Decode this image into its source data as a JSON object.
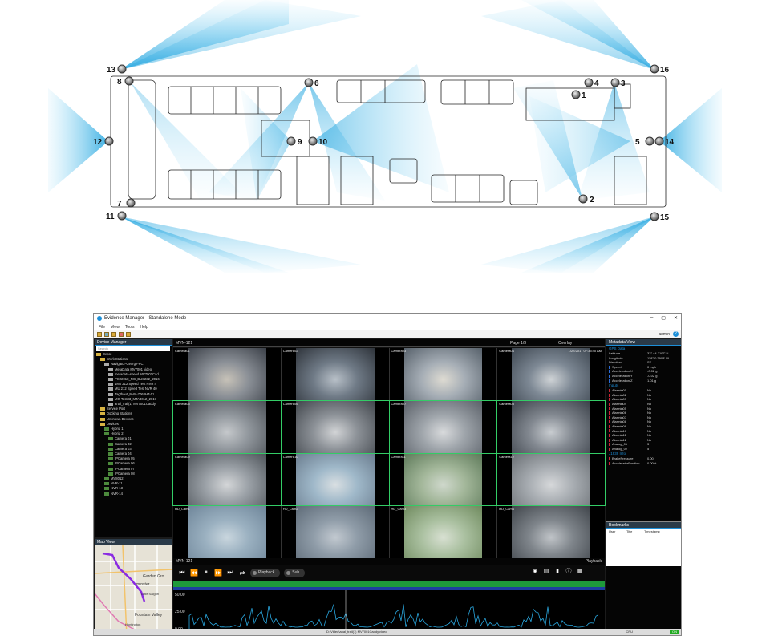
{
  "bus_diagram": {
    "cameras": [
      {
        "num": "1"
      },
      {
        "num": "2"
      },
      {
        "num": "3"
      },
      {
        "num": "4"
      },
      {
        "num": "5"
      },
      {
        "num": "6"
      },
      {
        "num": "7"
      },
      {
        "num": "8"
      },
      {
        "num": "9"
      },
      {
        "num": "10"
      },
      {
        "num": "11"
      },
      {
        "num": "12"
      },
      {
        "num": "13"
      },
      {
        "num": "14"
      },
      {
        "num": "15"
      },
      {
        "num": "16"
      }
    ]
  },
  "app": {
    "title": "Evidence Manager - Standalone Mode",
    "window_controls": [
      "–",
      "▢",
      "✕"
    ],
    "menu": [
      "File",
      "View",
      "Tools",
      "Help"
    ],
    "user": "admin",
    "device_manager": {
      "header": "Device Manager",
      "search_placeholder": "Search",
      "tree": [
        {
          "label": "Depot",
          "type": "folder",
          "indent": 0
        },
        {
          "label": "Work Stations",
          "type": "folder",
          "indent": 1
        },
        {
          "label": "Navigator-George-PC",
          "type": "device",
          "indent": 2
        },
        {
          "label": "MetaData MV7001 video",
          "type": "file",
          "indent": 3
        },
        {
          "label": "metadata-speed MV7001Cad",
          "type": "file",
          "indent": 3
        },
        {
          "label": "PC22018_RG_BUS232_2016",
          "type": "file",
          "indent": 3
        },
        {
          "label": "1M0 212 Speed Test NVR 4",
          "type": "file",
          "indent": 3
        },
        {
          "label": "MU 212 Speed Test NVR 40",
          "type": "file",
          "indent": 3
        },
        {
          "label": "Tagthout_NVN-7068HT-01",
          "type": "file",
          "indent": 3
        },
        {
          "label": "MG Test33_MTA3012_2017",
          "type": "file",
          "indent": 3
        },
        {
          "label": "anal_trail(1) MV7001Caddy",
          "type": "file",
          "indent": 3
        },
        {
          "label": "Service Port",
          "type": "folder",
          "indent": 1
        },
        {
          "label": "Docking Stations",
          "type": "folder",
          "indent": 1
        },
        {
          "label": "Unknown Devices",
          "type": "folder",
          "indent": 1
        },
        {
          "label": "Devices",
          "type": "folder",
          "indent": 1
        },
        {
          "label": "Hybrid 1",
          "type": "camera",
          "indent": 2
        },
        {
          "label": "Hybrid 2",
          "type": "camera",
          "indent": 2
        },
        {
          "label": "Camera 01",
          "type": "camera",
          "indent": 3
        },
        {
          "label": "Camera 02",
          "type": "camera",
          "indent": 3
        },
        {
          "label": "Camera 03",
          "type": "camera",
          "indent": 3
        },
        {
          "label": "Camera 04",
          "type": "camera",
          "indent": 3
        },
        {
          "label": "IPCamera 05",
          "type": "camera",
          "indent": 3
        },
        {
          "label": "IPCamera 06",
          "type": "camera",
          "indent": 3
        },
        {
          "label": "IPCamera 07",
          "type": "camera",
          "indent": 3
        },
        {
          "label": "IPCamera 08",
          "type": "camera",
          "indent": 3
        },
        {
          "label": "MV8012",
          "type": "camera",
          "indent": 2
        },
        {
          "label": "NVR-11",
          "type": "camera",
          "indent": 2
        },
        {
          "label": "NVR-13",
          "type": "camera",
          "indent": 2
        },
        {
          "label": "NVR-14",
          "type": "camera",
          "indent": 2
        }
      ]
    },
    "map_view": {
      "header": "Map View",
      "places": [
        "Garden Gro",
        "minster",
        "Little Saigon",
        "Fountain Valley",
        "Huntington"
      ],
      "attribution": "Data, imagery and map information provided by Open Stre"
    },
    "video": {
      "title": "MVN-121",
      "page": "Page 1/3",
      "overlay": "Overlay",
      "timestamp": "1/27/2017 07:35:40 AM",
      "cells": [
        {
          "label": "Camera01"
        },
        {
          "label": "Camera02"
        },
        {
          "label": "Camera03"
        },
        {
          "label": "Camera04"
        },
        {
          "label": "Camera05"
        },
        {
          "label": "Camera06"
        },
        {
          "label": "Camera07"
        },
        {
          "label": "Camera08"
        },
        {
          "label": "Camera09"
        },
        {
          "label": "Camera10"
        },
        {
          "label": "Camera11"
        },
        {
          "label": "Camera12"
        },
        {
          "label": "HD_Cam1"
        },
        {
          "label": "HD_Cam2"
        },
        {
          "label": "HD_Cam3"
        },
        {
          "label": "HD_Cam4"
        }
      ],
      "lower_title": "MVN-121",
      "playback_label": "Playback",
      "play_btn": "Playback",
      "sub_btn": "Sub",
      "wave_ticks": [
        "50.00",
        "25.00",
        "0.00"
      ]
    },
    "metadata": {
      "header": "Metadata View",
      "gps_title": "GPS Data",
      "gps": [
        {
          "k": "Latitude",
          "v": "33° 44.7107' N",
          "c": ""
        },
        {
          "k": "Longitude",
          "v": "118° 0.3903' W",
          "c": ""
        },
        {
          "k": "Direction",
          "v": "SE",
          "c": ""
        },
        {
          "k": "Speed",
          "v": "0 mph",
          "c": "#2a6cd8"
        },
        {
          "k": "Acceleration X",
          "v": "-0.02 g",
          "c": "#2a6cd8"
        },
        {
          "k": "Acceleration Y",
          "v": "-0.02 g",
          "c": "#2a6cd8"
        },
        {
          "k": "Acceleration Z",
          "v": "1.01 g",
          "c": "#2a6cd8"
        }
      ],
      "inputs_title": "Inputs",
      "inputs": [
        {
          "k": "Alarmin01",
          "v": "No",
          "c": "#c23"
        },
        {
          "k": "Alarmin02",
          "v": "No",
          "c": "#c23"
        },
        {
          "k": "Alarmin03",
          "v": "No",
          "c": "#c23"
        },
        {
          "k": "Alarmin04",
          "v": "No",
          "c": "#c23"
        },
        {
          "k": "Alarmin05",
          "v": "No",
          "c": "#c23"
        },
        {
          "k": "Alarmin06",
          "v": "No",
          "c": "#c23"
        },
        {
          "k": "Alarmin07",
          "v": "No",
          "c": "#c23"
        },
        {
          "k": "Alarmin08",
          "v": "No",
          "c": "#c23"
        },
        {
          "k": "Alarmin09",
          "v": "No",
          "c": "#c23"
        },
        {
          "k": "Alarmin10",
          "v": "No",
          "c": "#c23"
        },
        {
          "k": "Alarmin11",
          "v": "No",
          "c": "#c23"
        },
        {
          "k": "Alarmin12",
          "v": "No",
          "c": "#c23"
        },
        {
          "k": "Analog_01",
          "v": "3",
          "c": "#c23"
        },
        {
          "k": "Analog_02",
          "v": "5",
          "c": "#c23"
        }
      ],
      "j1939_title": "J1939 Info",
      "j1939": [
        {
          "k": "BrakePressure",
          "v": "0.00",
          "c": "#c23"
        },
        {
          "k": "AcceleratorPosition",
          "v": "0.00%",
          "c": "#c23"
        }
      ],
      "bookmarks_header": "Bookmarks",
      "bookmark_cols": [
        "User",
        "Title",
        "Timestamp"
      ]
    },
    "status": {
      "file": "D:\\Video\\anal_trail(1) MV7001Caddy.video",
      "cpu": "CPU",
      "on": "ON"
    }
  },
  "colors": {
    "accent": "#1d8fd8",
    "cone": "#4fc3f7",
    "green": "#1e9a3a"
  }
}
